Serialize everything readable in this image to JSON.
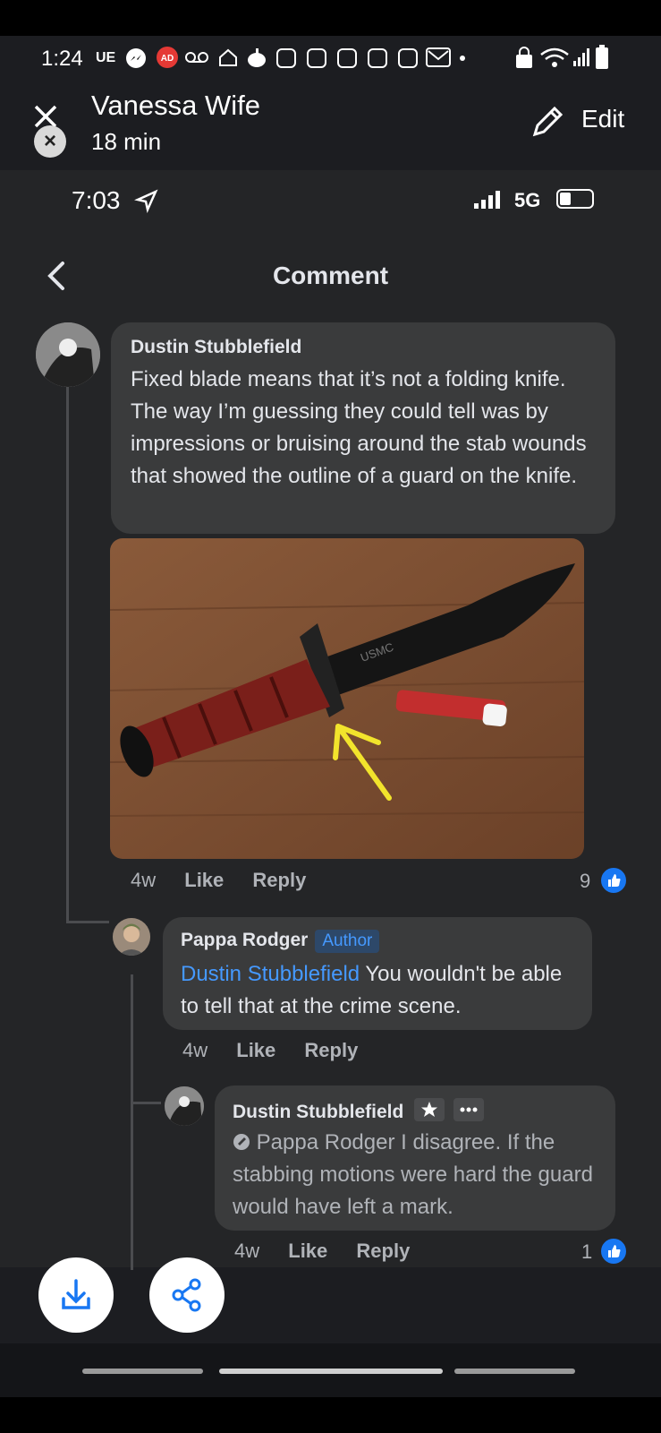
{
  "outer_status": {
    "time": "1:24",
    "carrier": "UE"
  },
  "story": {
    "title": "Vanessa Wife",
    "age": "18 min",
    "edit_label": "Edit"
  },
  "inner_status": {
    "time": "7:03",
    "network": "5G"
  },
  "screen": {
    "title": "Comment"
  },
  "comments": [
    {
      "author": "Dustin Stubblefield",
      "text": "Fixed blade means that it’s not a folding knife. The way I’m guessing they could tell was by impressions or bruising around the stab wounds that showed the outline of a guard on the knife.",
      "time": "4w",
      "like": "Like",
      "reply": "Reply",
      "reactions": "9"
    },
    {
      "author": "Pappa Rodger",
      "badge": "Author",
      "mention": "Dustin Stubblefield",
      "text": " You wouldn't be able to tell that at the crime scene.",
      "time": "4w",
      "like": "Like",
      "reply": "Reply"
    },
    {
      "author": "Dustin Stubblefield",
      "mention": "Pappa Rodger",
      "text": " I disagree. If the stabbing motions were hard the guard would have left a mark.",
      "time": "4w",
      "like": "Like",
      "reply": "Reply",
      "reactions": "1"
    }
  ],
  "knife_brand": "USMC",
  "icons": [
    "close-icon",
    "pencil-icon",
    "back-chevron-icon",
    "like-icon",
    "star-icon",
    "more-icon",
    "download-icon",
    "share-icon"
  ],
  "colors": {
    "link": "#4599ff",
    "like_blue": "#1877f2",
    "arrow": "#f2e42c"
  }
}
